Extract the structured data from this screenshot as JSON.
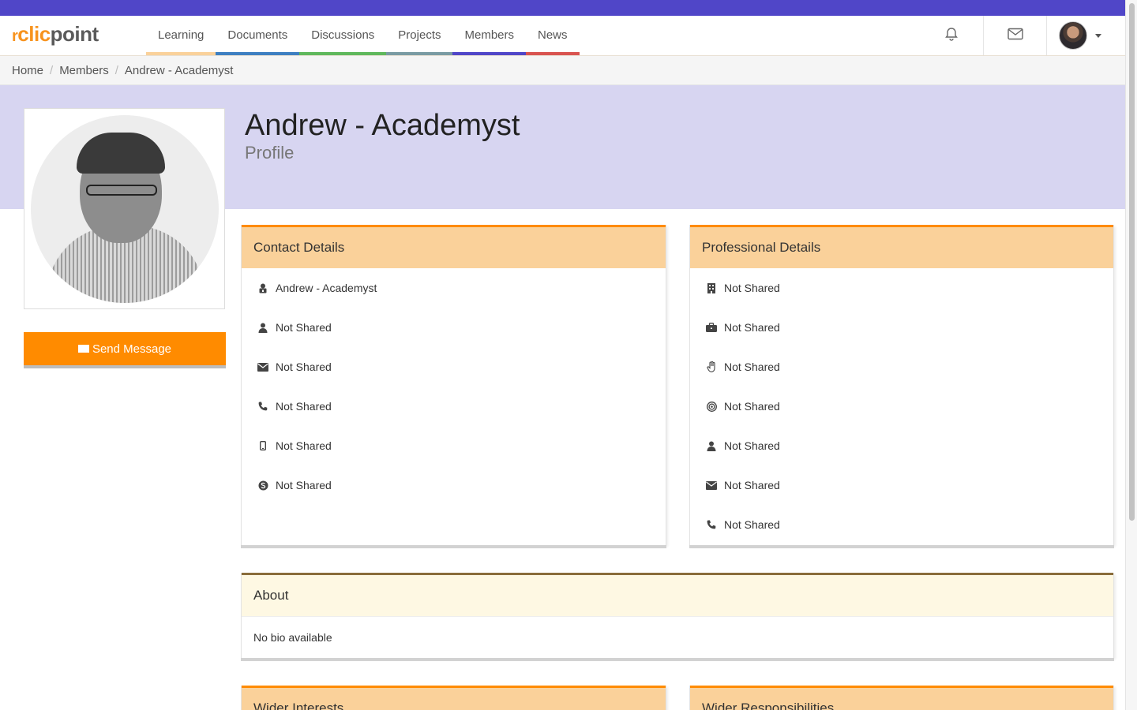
{
  "brand": {
    "logo_mark": "r",
    "logo_clic": "clic",
    "logo_point": "point",
    "accent": "#f7931e"
  },
  "nav": {
    "items": [
      {
        "label": "Learning",
        "color": "#fad19a"
      },
      {
        "label": "Documents",
        "color": "#3d7fc1"
      },
      {
        "label": "Discussions",
        "color": "#5fb85c"
      },
      {
        "label": "Projects",
        "color": "#7a9ba3"
      },
      {
        "label": "Members",
        "color": "#5046c8"
      },
      {
        "label": "News",
        "color": "#d9534f"
      }
    ],
    "icons": [
      "bell-icon",
      "envelope-icon"
    ]
  },
  "breadcrumb": {
    "items": [
      "Home",
      "Members",
      "Andrew - Academyst"
    ],
    "separator": "/"
  },
  "profile": {
    "title": "Andrew - Academyst",
    "subtitle": "Profile",
    "send_message_label": "Send Message"
  },
  "contact": {
    "heading": "Contact Details",
    "rows": [
      {
        "icon": "user-lock-icon",
        "text": "Andrew - Academyst"
      },
      {
        "icon": "user-icon",
        "text": "Not Shared"
      },
      {
        "icon": "envelope-icon",
        "text": "Not Shared"
      },
      {
        "icon": "phone-icon",
        "text": "Not Shared"
      },
      {
        "icon": "mobile-icon",
        "text": "Not Shared"
      },
      {
        "icon": "skype-icon",
        "text": "Not Shared"
      }
    ]
  },
  "professional": {
    "heading": "Professional Details",
    "rows": [
      {
        "icon": "building-icon",
        "text": "Not Shared"
      },
      {
        "icon": "briefcase-icon",
        "text": "Not Shared"
      },
      {
        "icon": "hand-icon",
        "text": "Not Shared"
      },
      {
        "icon": "target-icon",
        "text": "Not Shared"
      },
      {
        "icon": "user-icon",
        "text": "Not Shared"
      },
      {
        "icon": "envelope-icon",
        "text": "Not Shared"
      },
      {
        "icon": "phone-icon",
        "text": "Not Shared"
      }
    ]
  },
  "about": {
    "heading": "About",
    "text": "No bio available"
  },
  "lower_panels": {
    "left_heading": "Wider Interests",
    "right_heading": "Wider Responsibilities"
  },
  "colors": {
    "top_bar": "#5046c8",
    "hero_bg": "#d7d5f1",
    "panel_head": "#fad19a",
    "panel_accent": "#ff8b00",
    "button": "#ff8b00"
  }
}
